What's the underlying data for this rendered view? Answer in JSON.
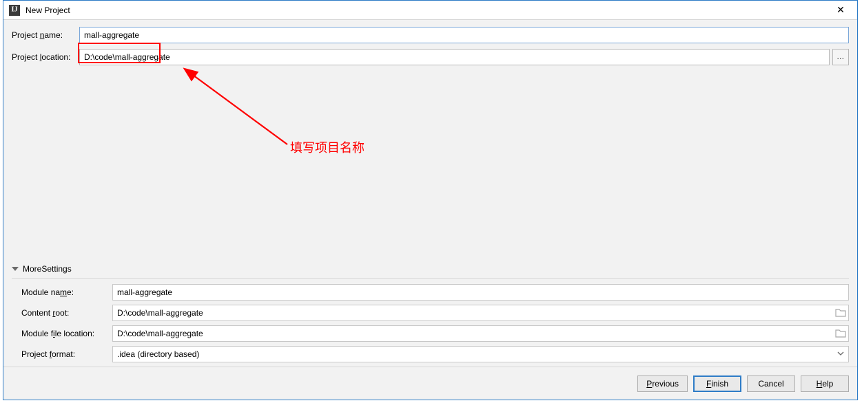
{
  "window": {
    "title": "New Project",
    "close_symbol": "✕"
  },
  "app_icon_text": "IJ",
  "form": {
    "project_name_label_before": "Project ",
    "project_name_label_mn": "n",
    "project_name_label_after": "ame:",
    "project_name_value": "mall-aggregate",
    "project_location_label_before": "Project ",
    "project_location_label_mn": "l",
    "project_location_label_after": "ocation:",
    "project_location_value": "D:\\code\\mall-aggregate",
    "browse_symbol": "..."
  },
  "annotation": {
    "text": "填写项目名称"
  },
  "more": {
    "header_before": "Mor",
    "header_mn": "e",
    "header_after": " Settings",
    "module_name_label_before": "Module na",
    "module_name_label_mn": "m",
    "module_name_label_after": "e:",
    "module_name_value": "mall-aggregate",
    "content_root_label_before": "Content ",
    "content_root_label_mn": "r",
    "content_root_label_after": "oot:",
    "content_root_value": "D:\\code\\mall-aggregate",
    "module_file_loc_label_before": "Module f",
    "module_file_loc_label_mn": "i",
    "module_file_loc_label_after": "le location:",
    "module_file_loc_value": "D:\\code\\mall-aggregate",
    "project_format_label_before": "Project ",
    "project_format_label_mn": "f",
    "project_format_label_after": "ormat:",
    "project_format_value": ".idea (directory based)"
  },
  "footer": {
    "previous_before": "",
    "previous_mn": "P",
    "previous_after": "revious",
    "finish_before": "",
    "finish_mn": "F",
    "finish_after": "inish",
    "cancel": "Cancel",
    "help_before": "",
    "help_mn": "H",
    "help_after": "elp"
  }
}
